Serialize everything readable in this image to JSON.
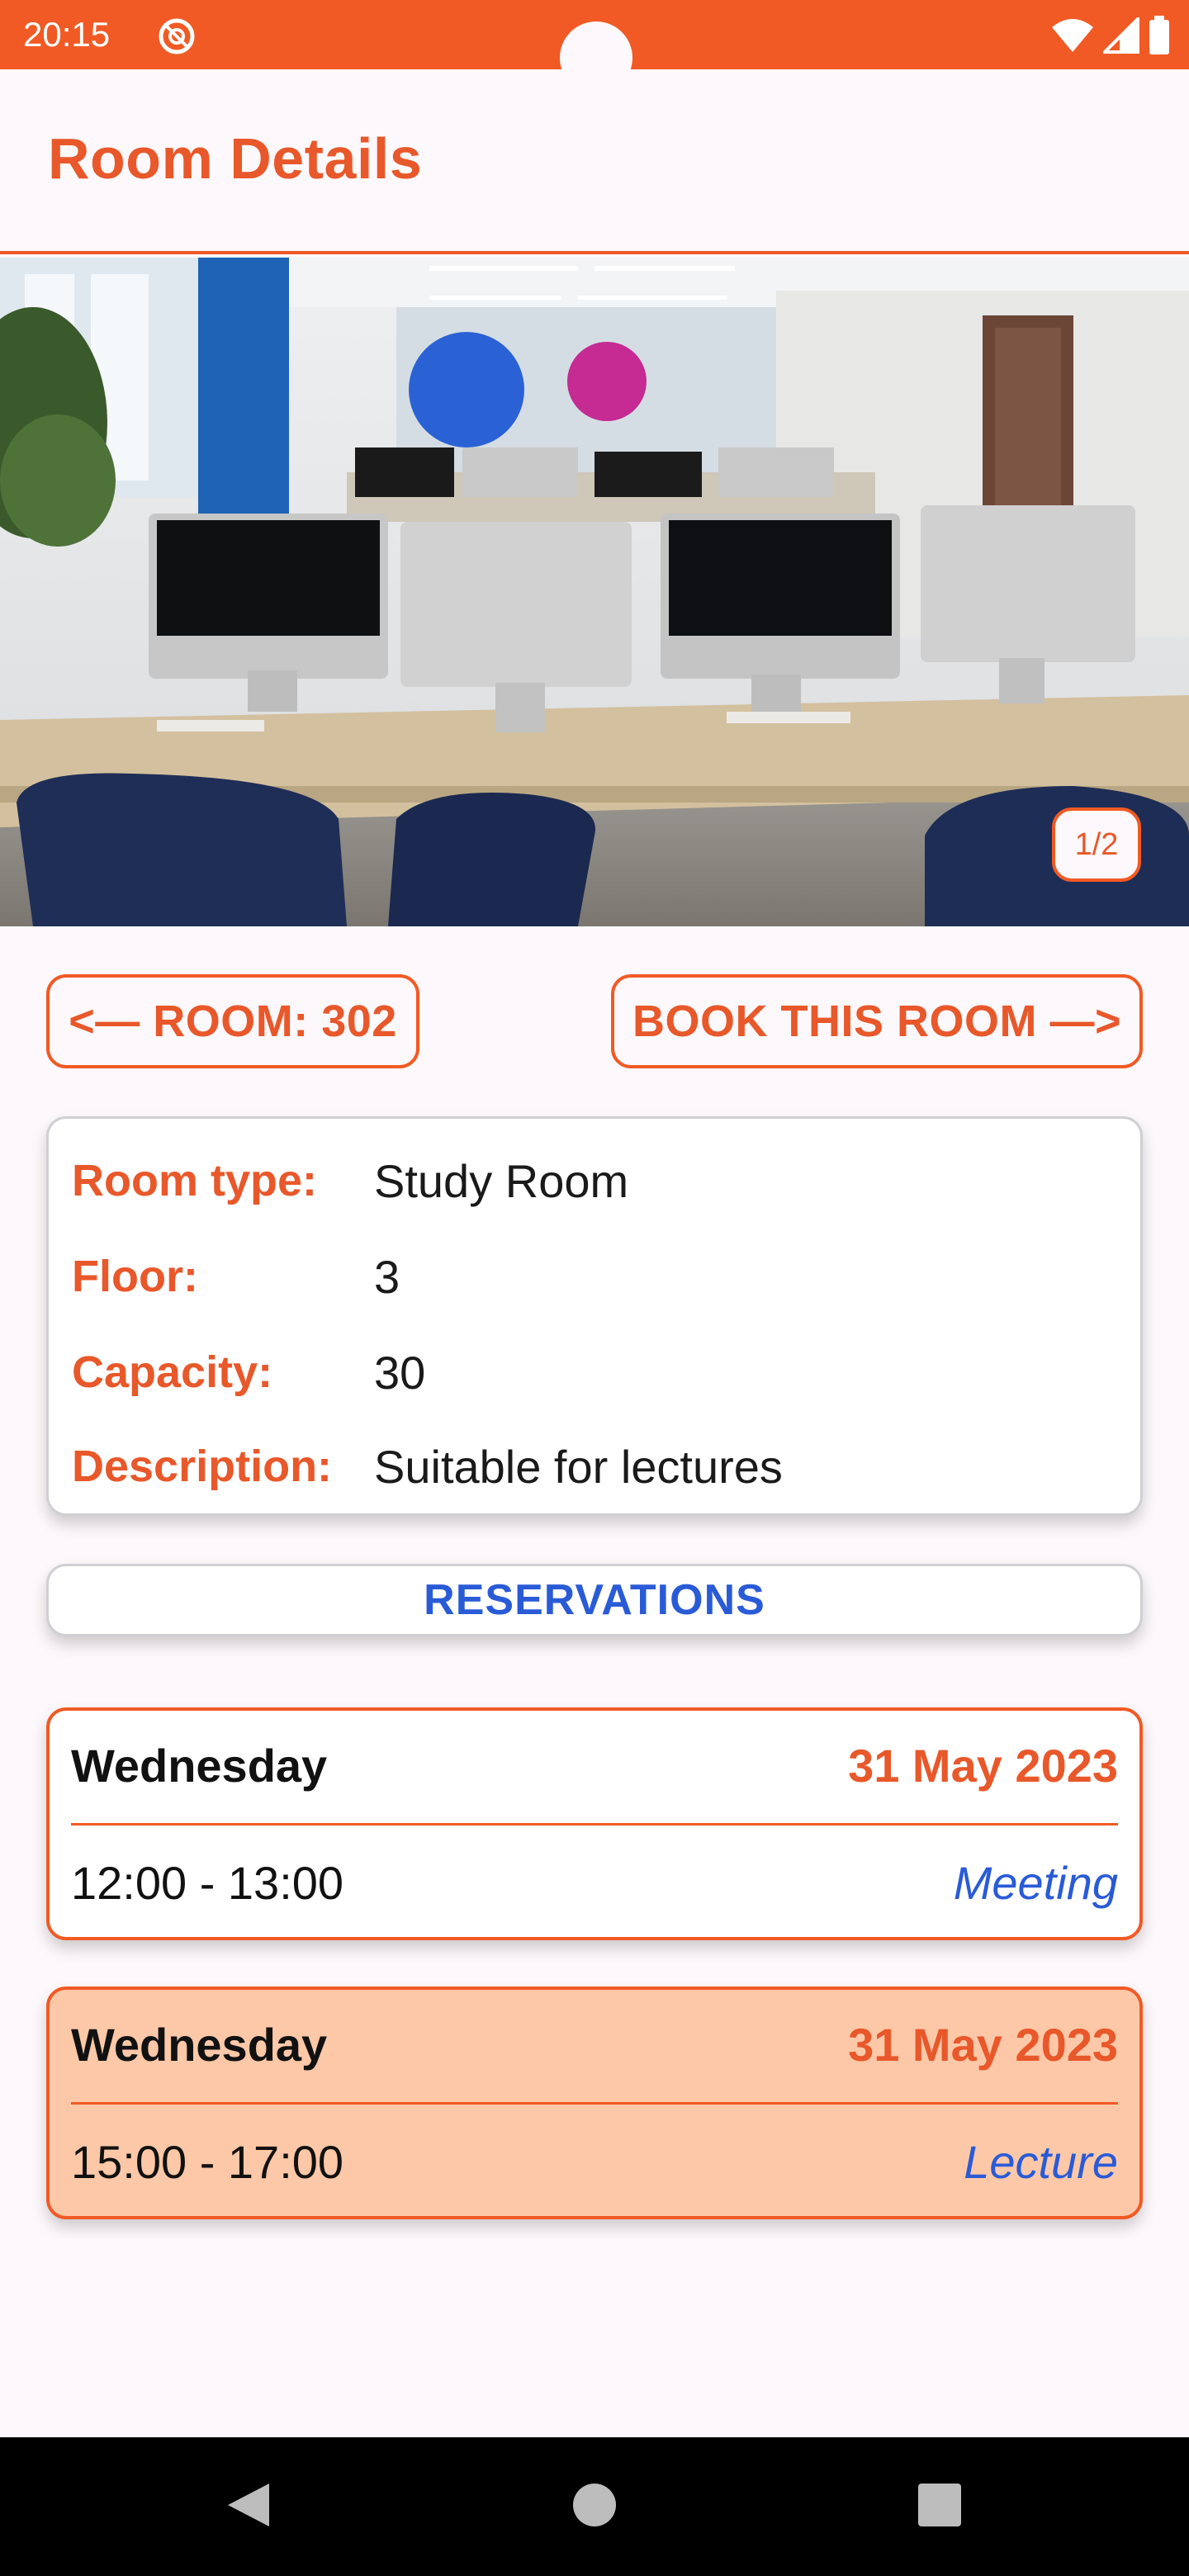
{
  "status_bar": {
    "time": "20:15",
    "icons": [
      "do-not-disturb-icon",
      "wifi-icon",
      "signal-icon",
      "battery-icon"
    ],
    "color": "#f15a24"
  },
  "header": {
    "title": "Room Details"
  },
  "gallery": {
    "counter": "1/2",
    "image_alt": "Study room with computers on desks"
  },
  "nav": {
    "room_button": "<— ROOM: 302",
    "book_button": "BOOK THIS ROOM —>"
  },
  "room_info": {
    "rows": [
      {
        "label": "Room type:",
        "value": "Study Room"
      },
      {
        "label": "Floor:",
        "value": "3"
      },
      {
        "label": "Capacity:",
        "value": "30"
      },
      {
        "label": "Description:",
        "value": "Suitable for lectures"
      }
    ]
  },
  "reservations": {
    "header": "RESERVATIONS",
    "items": [
      {
        "day": "Wednesday",
        "date": "31 May 2023",
        "time": "12:00 - 13:00",
        "type": "Meeting"
      },
      {
        "day": "Wednesday",
        "date": "31 May 2023",
        "time": "15:00 - 17:00",
        "type": "Lecture"
      }
    ]
  },
  "system_nav": {
    "icons": [
      "back-icon",
      "home-icon",
      "recents-icon"
    ]
  },
  "colors": {
    "accent": "#f15a24",
    "link_blue": "#2a5bd7",
    "highlight_card": "#fdc8a8"
  }
}
